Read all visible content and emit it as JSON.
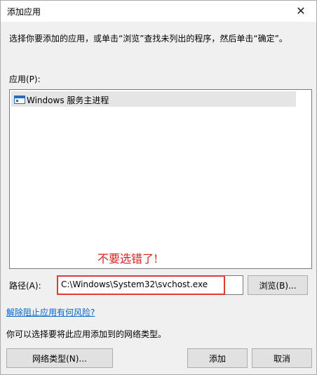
{
  "window": {
    "title": "添加应用",
    "close_glyph": "✕"
  },
  "instruction": "选择你要添加的应用，或单击“浏览”查找未列出的程序，然后单击“确定”。",
  "apps": {
    "label": "应用(P):",
    "items": [
      {
        "label": "Windows 服务主进程",
        "icon": "app-window-icon"
      }
    ]
  },
  "annotation": "不要选错了!",
  "path": {
    "label": "路径(A):",
    "value": "C:\\Windows\\System32\\svchost.exe"
  },
  "buttons": {
    "browse": "浏览(B)...",
    "network_type": "网络类型(N)...",
    "add": "添加",
    "cancel": "取消"
  },
  "links": {
    "risk": "解除阻止应用有何风险?"
  },
  "network_text": "你可以选择要将此应用添加到的网络类型。",
  "colors": {
    "annotation_red": "#e02020",
    "link_blue": "#0066cc"
  }
}
